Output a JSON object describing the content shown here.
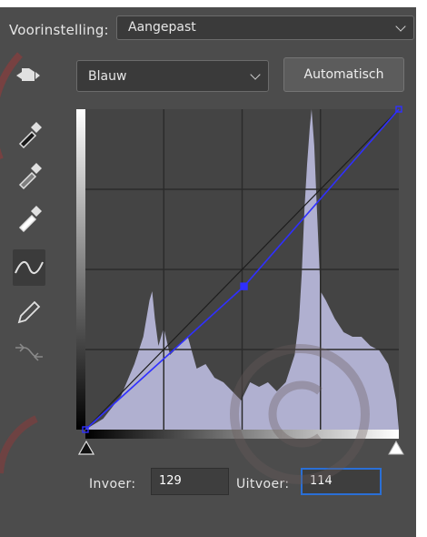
{
  "header": {
    "preset_label": "Voorinstelling:",
    "preset_value": "Aangepast",
    "channel_value": "Blauw",
    "auto_button": "Automatisch"
  },
  "tools": [
    {
      "icon": "hand-adjust-icon"
    },
    {
      "icon": "eyedropper-black-icon"
    },
    {
      "icon": "eyedropper-gray-icon"
    },
    {
      "icon": "eyedropper-white-icon"
    },
    {
      "icon": "curve-point-icon",
      "active": true
    },
    {
      "icon": "pencil-icon"
    },
    {
      "icon": "smooth-curve-icon",
      "disabled": true
    }
  ],
  "curve": {
    "channel_color": "#2f2fff",
    "points": [
      [
        0,
        0
      ],
      [
        129,
        114
      ],
      [
        255,
        255
      ]
    ],
    "grid_divisions": 4
  },
  "io": {
    "input_label": "Invoer:",
    "input_value": "129",
    "output_label": "Uitvoer:",
    "output_value": "114"
  },
  "colors": {
    "panel": "#4c4c4c",
    "histogram": "#b0b0d0",
    "focus": "#2a6fd6"
  }
}
